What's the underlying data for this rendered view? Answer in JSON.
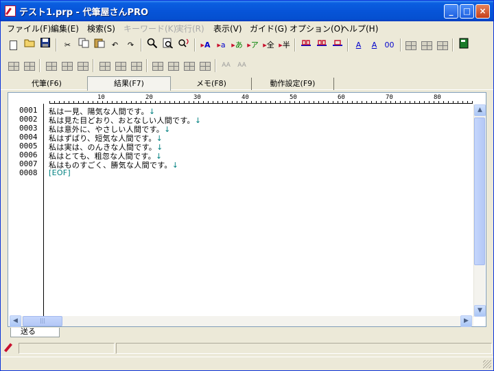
{
  "window": {
    "title": "テスト1.prp - 代筆屋さんPRO",
    "caption_buttons": [
      "_",
      "□",
      "×"
    ]
  },
  "menu": [
    {
      "label": "ファイル(F)",
      "enabled": true
    },
    {
      "label": "編集(E)",
      "enabled": true
    },
    {
      "label": "検索(S)",
      "enabled": true
    },
    {
      "label": "キーワード(K)",
      "enabled": false
    },
    {
      "label": "実行(R)",
      "enabled": false
    },
    {
      "label": "表示(V)",
      "enabled": true
    },
    {
      "label": "ガイド(G)",
      "enabled": true
    },
    {
      "label": "オプション(O)",
      "enabled": true
    },
    {
      "label": "ヘルプ(H)",
      "enabled": true
    }
  ],
  "toolbar_glyphs": {
    "bold_A": "A",
    "a": "a",
    "hira": "あ",
    "kata": "ア",
    "zen": "全",
    "han": "半",
    "aa1": "AA",
    "aa2": "AA",
    "oo": "00"
  },
  "tabs": [
    {
      "label": "代筆(F6)",
      "active": false
    },
    {
      "label": "結果(F7)",
      "active": true
    },
    {
      "label": "メモ(F8)",
      "active": false
    },
    {
      "label": "動作設定(F9)",
      "active": false
    }
  ],
  "ruler": {
    "marks": [
      "10",
      "20",
      "30",
      "40",
      "50",
      "60",
      "70",
      "80"
    ]
  },
  "editor": {
    "lines": [
      {
        "num": "0001",
        "text": "私は一見、陽気な人間です。",
        "ret": "↓"
      },
      {
        "num": "0002",
        "text": "私は見た目どおり、おとなしい人間です。",
        "ret": "↓"
      },
      {
        "num": "0003",
        "text": "私は意外に、やさしい人間です。",
        "ret": "↓"
      },
      {
        "num": "0004",
        "text": "私はずばり、短気な人間です。",
        "ret": "↓"
      },
      {
        "num": "0005",
        "text": "私は実は、のんきな人間です。",
        "ret": "↓"
      },
      {
        "num": "0006",
        "text": "私はとても、粗忽な人間です。",
        "ret": "↓"
      },
      {
        "num": "0007",
        "text": "私はものすごく、勝気な人間です。",
        "ret": "↓"
      },
      {
        "num": "0008",
        "text": "[EOF]",
        "ret": ""
      }
    ]
  },
  "bottom_tab": {
    "label": "送る"
  },
  "colors": {
    "title_blue": "#0754d8",
    "return_mark": "#008080",
    "accent_blue": "#0000cc",
    "accent_red": "#c8102e",
    "accent_green": "#008000"
  }
}
